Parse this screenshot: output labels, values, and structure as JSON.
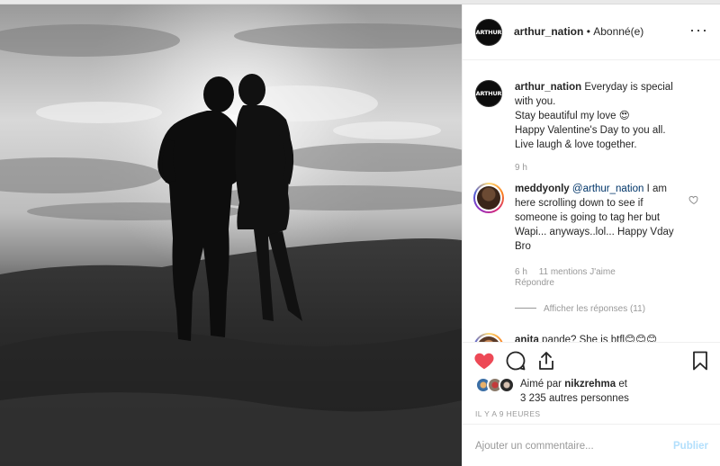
{
  "post": {
    "username": "arthur_nation",
    "separator": "•",
    "follow_status": "Abonné(e)",
    "avatar_text": "ARTHUR",
    "more_icon": "more-horizontal-icon"
  },
  "caption": {
    "username": "arthur_nation",
    "text": "Everyday is special with you.\nStay beautiful my love 😍\nHappy Valentine's Day to you all.\nLive laugh & love together.",
    "time": "9 h"
  },
  "comments": [
    {
      "username": "meddyonly",
      "mention": "@arthur_nation",
      "text": "I am here scrolling down to see if someone is going to tag her but Wapi... anyways..lol... Happy Vday Bro",
      "time": "6 h",
      "likes": "11 mentions J'aime",
      "reply": "Répondre",
      "show_replies": "Afficher les réponses (11)"
    },
    {
      "username": "anita",
      "text": "pande? She is btfl😊😊😊"
    }
  ],
  "actions": {
    "like_icon": "heart-filled-icon",
    "comment_icon": "comment-icon",
    "share_icon": "share-icon",
    "save_icon": "bookmark-icon",
    "like_color": "#ed4956"
  },
  "likes": {
    "prefix": "Aimé par",
    "user": "nikzrehma",
    "conj": "et",
    "others": "3 235 autres personnes"
  },
  "timestamp": "IL Y A 9 HEURES",
  "add_comment": {
    "placeholder": "Ajouter un commentaire...",
    "post_label": "Publier"
  }
}
